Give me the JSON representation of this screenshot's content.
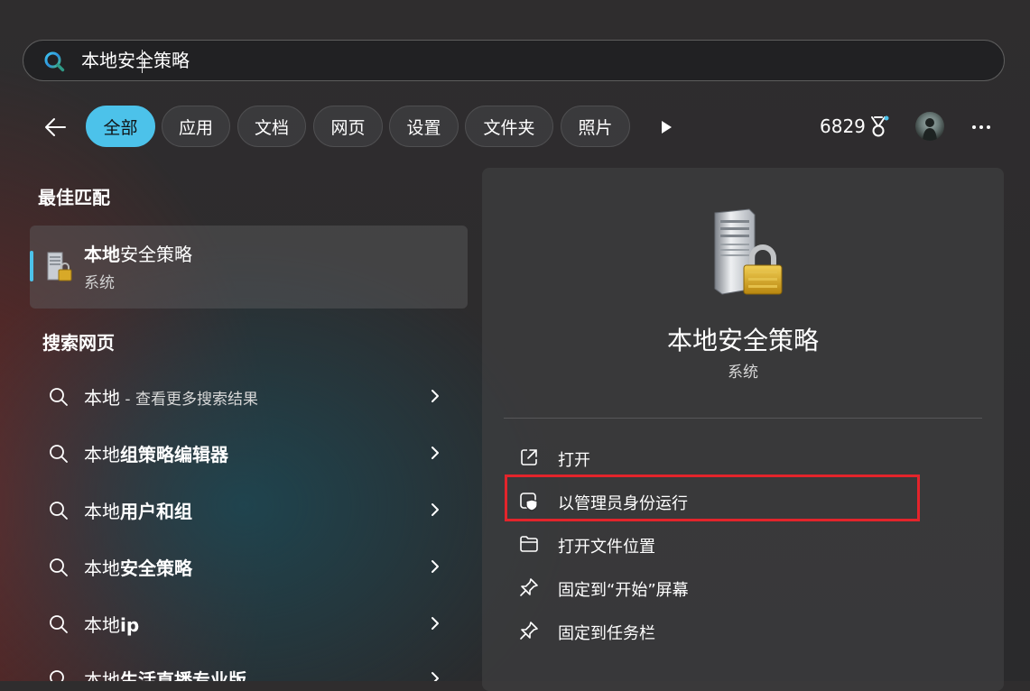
{
  "search": {
    "value": "本地安全策略"
  },
  "filters": [
    {
      "label": "全部",
      "active": true
    },
    {
      "label": "应用"
    },
    {
      "label": "文档"
    },
    {
      "label": "网页"
    },
    {
      "label": "设置"
    },
    {
      "label": "文件夹"
    },
    {
      "label": "照片"
    }
  ],
  "rewards": {
    "points": "6829"
  },
  "best_match": {
    "section_title": "最佳匹配",
    "title_bold": "本地",
    "title_rest": "安全策略",
    "subtitle": "系统"
  },
  "web_search": {
    "section_title": "搜索网页",
    "items": [
      {
        "prefix": "本地",
        "bold": "",
        "hint": " - 查看更多搜索结果"
      },
      {
        "prefix": "本地",
        "bold": "组策略编辑器",
        "hint": ""
      },
      {
        "prefix": "本地",
        "bold": "用户和组",
        "hint": ""
      },
      {
        "prefix": "本地",
        "bold": "安全策略",
        "hint": ""
      },
      {
        "prefix": "本地",
        "bold": "ip",
        "hint": ""
      },
      {
        "prefix": "本地",
        "bold": "生活直播专业版",
        "hint": ""
      }
    ]
  },
  "detail": {
    "title": "本地安全策略",
    "subtitle": "系统",
    "actions": [
      {
        "label": "打开",
        "icon": "open-external-icon"
      },
      {
        "label": "以管理员身份运行",
        "icon": "shield-admin-icon"
      },
      {
        "label": "打开文件位置",
        "icon": "folder-icon"
      },
      {
        "label": "固定到“开始”屏幕",
        "icon": "pin-icon"
      },
      {
        "label": "固定到任务栏",
        "icon": "pin-icon"
      }
    ]
  },
  "colors": {
    "accent": "#4cc2ea",
    "highlight": "#e3242b"
  }
}
